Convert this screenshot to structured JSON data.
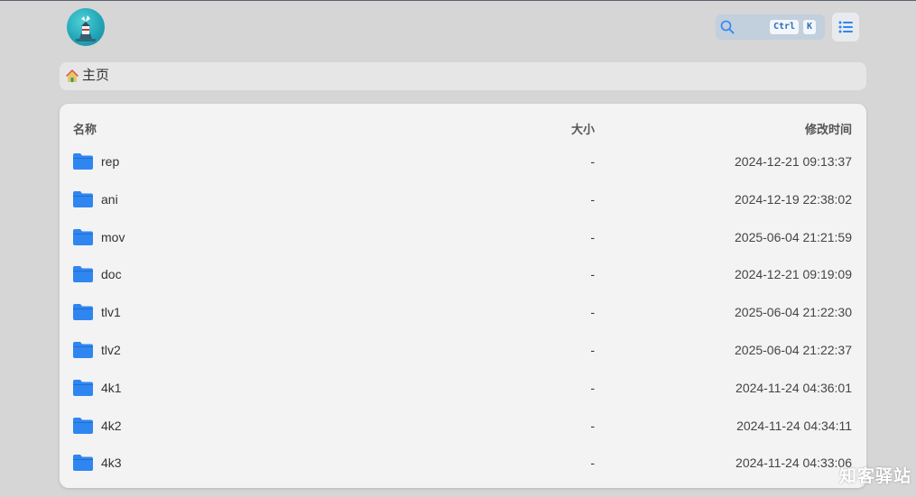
{
  "header": {
    "logo_icon": "lighthouse-logo",
    "search": {
      "icon": "search-icon",
      "shortcut_ctrl": "Ctrl",
      "shortcut_k": "K"
    },
    "view_toggle_icon": "list-icon"
  },
  "breadcrumb": {
    "home_icon": "home-icon",
    "label": "主页"
  },
  "table": {
    "headers": {
      "name": "名称",
      "size": "大小",
      "modified": "修改时间"
    },
    "rows": [
      {
        "name": "rep",
        "size": "-",
        "modified": "2024-12-21 09:13:37"
      },
      {
        "name": "ani",
        "size": "-",
        "modified": "2024-12-19 22:38:02"
      },
      {
        "name": "mov",
        "size": "-",
        "modified": "2025-06-04 21:21:59"
      },
      {
        "name": "doc",
        "size": "-",
        "modified": "2024-12-21 09:19:09"
      },
      {
        "name": "tlv1",
        "size": "-",
        "modified": "2025-06-04 21:22:30"
      },
      {
        "name": "tlv2",
        "size": "-",
        "modified": "2025-06-04 21:22:37"
      },
      {
        "name": "4k1",
        "size": "-",
        "modified": "2024-11-24 04:36:01"
      },
      {
        "name": "4k2",
        "size": "-",
        "modified": "2024-11-24 04:34:11"
      },
      {
        "name": "4k3",
        "size": "-",
        "modified": "2024-11-24 04:33:06"
      }
    ]
  },
  "watermark": "知客驿站",
  "colors": {
    "accent": "#2f86f0",
    "background": "#d6d6d6",
    "panel": "#f3f3f3"
  }
}
